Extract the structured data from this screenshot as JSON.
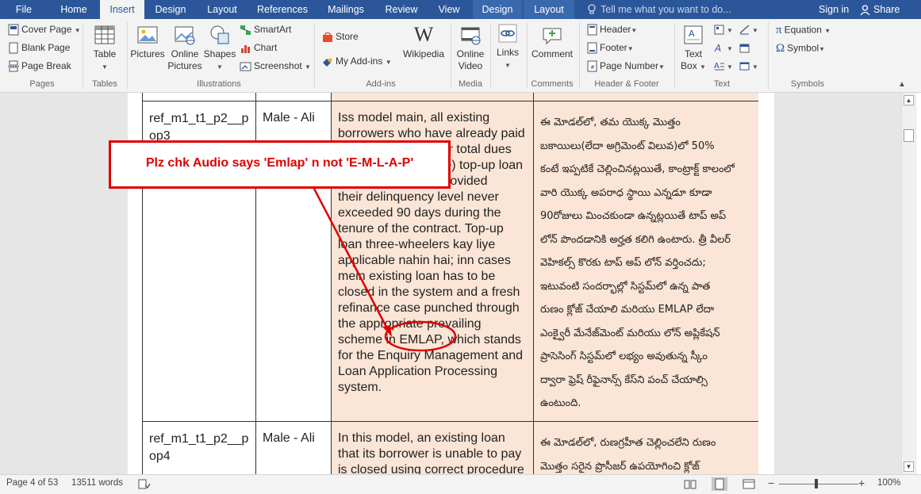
{
  "tabs": [
    "File",
    "Home",
    "Insert",
    "Design",
    "Layout",
    "References",
    "Mailings",
    "Review",
    "View",
    "Design",
    "Layout"
  ],
  "tell_me": "Tell me what you want to do...",
  "sign_in": "Sign in",
  "share": "Share",
  "ribbon": {
    "pages": {
      "cover_page": "Cover Page",
      "blank_page": "Blank Page",
      "page_break": "Page Break",
      "label": "Pages"
    },
    "tables": {
      "table": "Table",
      "label": "Tables"
    },
    "illustrations": {
      "pictures": "Pictures",
      "online_pictures_1": "Online",
      "online_pictures_2": "Pictures",
      "shapes": "Shapes",
      "smartart": "SmartArt",
      "chart": "Chart",
      "screenshot": "Screenshot",
      "label": "Illustrations"
    },
    "addins": {
      "store": "Store",
      "my_addins": "My Add-ins",
      "wikipedia": "Wikipedia",
      "label": "Add-ins"
    },
    "media": {
      "online_video_1": "Online",
      "online_video_2": "Video",
      "label": "Media"
    },
    "links": {
      "links": "Links"
    },
    "comments": {
      "comment": "Comment",
      "label": "Comments"
    },
    "header_footer": {
      "header": "Header",
      "footer": "Footer",
      "page_number": "Page Number",
      "label": "Header & Footer"
    },
    "text": {
      "text_box_1": "Text",
      "text_box_2": "Box",
      "label": "Text"
    },
    "symbols": {
      "equation": "Equation",
      "symbol": "Symbol",
      "label": "Symbols"
    }
  },
  "table_rows": [
    {
      "id_lines": [
        "ref_m1_t1_p2__p",
        "op3"
      ],
      "speaker": "Male - Ali",
      "english_lines": [
        "Iss model main, all existing",
        "borrowers who have already paid",
        "50% or more of their total dues",
        "(or agreement value) top-up loan",
        "would be eligible, provided",
        "their delinquency level never",
        "exceeded 90 days during the",
        "tenure of the contract. Top-up",
        "loan three-wheelers kay liye",
        "applicable nahin hai; inn cases",
        "mein existing loan has to be",
        "closed in the system and a fresh",
        "refinance case punched through",
        "the appropriate prevailing",
        "scheme in EMLAP, which stands",
        "for the Enquiry Management and",
        "Loan Application Processing",
        "system."
      ],
      "telugu_lines": [
        "ఈ మోడల్‌లో, తమ యొక్క మొత్తం",
        "బకాయిలు(లేదా అగ్రిమెంట్ విలువ)లో 50%",
        "కంటే ఇప్పటికే చెల్లించినట్లయితే, కాంట్రాక్ట్ కాలంలో",
        "వారి యొక్క  అపరాధ స్థాయి ఎన్నడూ కూడా",
        "90రోజులు మించకుండా ఉన్నట్లయితే టాప్ అప్",
        "లోన్ పొందడానికి అర్హత కలిగి ఉంటారు.  త్రీ వీలర్",
        "వెహికల్స్ కొరకు టాప్ అప్ లోన్ వర్తించదు;",
        "ఇటువంటి సందర్భాల్లో సిస్టమ్‌లో ఉన్న పాత",
        "రుణం క్లోజ్ చేయాలి మరియు EMLAP లేదా",
        "ఎంక్వైరీ మేనేజ్‌మెంట్ మరియు లోన్ అప్లికేషన్",
        "ప్రాసెసింగ్ సిస్టమ్‌లో లభ్యం అవుతున్న స్కీం",
        "ద్వారా ఫ్రెష్ రీఫైనాన్స్ కేస్‌ని పంచ్ చేయాల్సి",
        "ఉంటుంది."
      ]
    },
    {
      "id_lines": [
        "ref_m1_t1_p2__p",
        "op4"
      ],
      "speaker": "Male - Ali",
      "english_lines": [
        "In this model, an existing loan",
        "that its borrower is unable to pay",
        "is closed using correct procedure"
      ],
      "telugu_lines": [
        "ఈ మోడల్‌లో, రుణగ్రహీత చెల్లించలేని రుణం",
        "మొత్తం సరైన ప్రొసీజర్ ఉపయోగించి క్లోజ్"
      ]
    }
  ],
  "callout_text": "Plz chk Audio says 'Emlap' n not 'E-M-L-A-P'",
  "status": {
    "page": "Page 4 of 53",
    "words": "13511 words",
    "zoom": "100%"
  },
  "colors": {
    "ribbon_blue": "#2b579a",
    "cell_fill": "#fbe5d6",
    "annotation_red": "#e00000"
  }
}
